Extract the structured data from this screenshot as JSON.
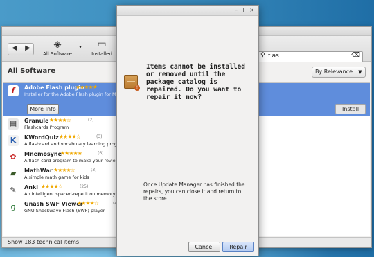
{
  "toolbar": {
    "back_icon": "left-arrow",
    "forward_icon": "right-arrow",
    "all_software": "All Software",
    "installed": "Installed"
  },
  "search": {
    "value": "flas"
  },
  "list_heading": "All Software",
  "sort": {
    "selected": "By Relevance"
  },
  "apps": [
    {
      "name": "Adobe Flash plugin",
      "desc": "Installer for the Adobe Flash plugin for Mozilla",
      "stars": "★★★★★",
      "count": ""
    },
    {
      "name": "Granule",
      "desc": "Flashcards Program",
      "stars": "★★★★☆",
      "count": "(2)"
    },
    {
      "name": "KWordQuiz",
      "desc": "A flashcard and vocabulary learning program",
      "stars": "★★★★☆",
      "count": "(3)"
    },
    {
      "name": "Mnemosyne",
      "desc": "A flash card program to make your review proc",
      "stars": "★★★★★",
      "count": "(6)"
    },
    {
      "name": "MathWar",
      "desc": "A simple math game for kids",
      "stars": "★★★★☆",
      "count": "(3)"
    },
    {
      "name": "Anki",
      "desc": "An intelligent spaced-repetition memory traini",
      "stars": "★★★★☆",
      "count": "(25)"
    },
    {
      "name": "Gnash SWF Viewer",
      "desc": "GNU Shockwave Flash (SWF) player",
      "stars": "★★★★☆",
      "count": "(4"
    }
  ],
  "buttons": {
    "more_info": "More Info",
    "install": "Install"
  },
  "status": "Show 183 technical items",
  "dialog": {
    "heading": "Items cannot be installed or removed until the package catalog is repaired. Do you want to repair it now?",
    "body": "Once Update Manager has finished the repairs, you can close it and return to the store.",
    "cancel": "Cancel",
    "repair": "Repair"
  }
}
